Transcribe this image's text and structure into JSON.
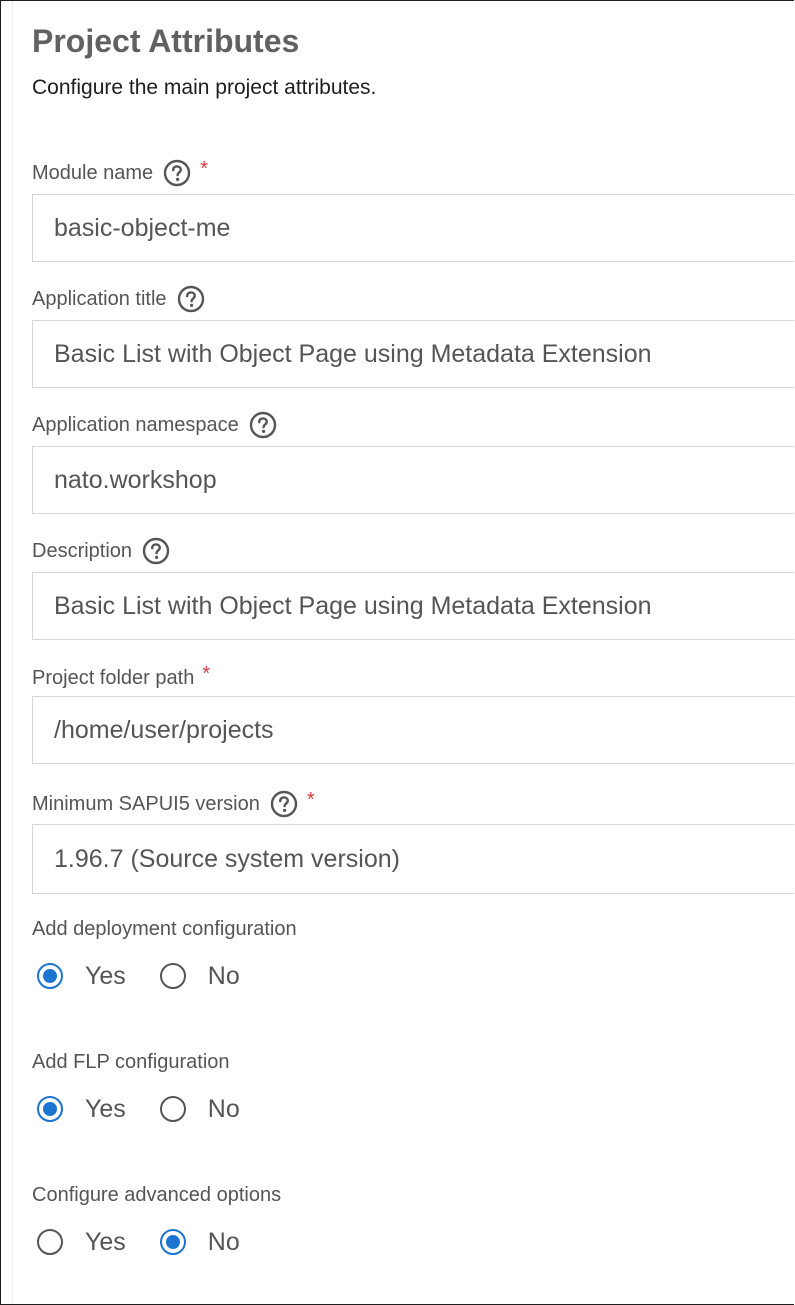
{
  "header": {
    "title": "Project Attributes",
    "subtitle": "Configure the main project attributes."
  },
  "fields": [
    {
      "label": "Module name",
      "value": "basic-object-me",
      "help": true,
      "required": true,
      "help_icon": "question-circle-icon"
    },
    {
      "label": "Application title",
      "value": "Basic List with Object Page using Metadata Extension",
      "help": true,
      "required": false
    },
    {
      "label": "Application namespace",
      "value": "nato.workshop",
      "help": true,
      "required": false
    },
    {
      "label": "Description",
      "value": "Basic List with Object Page using Metadata Extension",
      "help": true,
      "required": false
    },
    {
      "label": "Project folder path",
      "value": "/home/user/projects",
      "help": false,
      "required": true
    },
    {
      "label": "Minimum SAPUI5 version",
      "value": "1.96.7 (Source system version)",
      "help": true,
      "required": true
    }
  ],
  "required_marker": "*",
  "radio_groups": [
    {
      "label": "Add deployment configuration",
      "options": [
        "Yes",
        "No"
      ],
      "selected": "Yes"
    },
    {
      "label": "Add FLP configuration",
      "options": [
        "Yes",
        "No"
      ],
      "selected": "Yes"
    },
    {
      "label": "Configure advanced options",
      "options": [
        "Yes",
        "No"
      ],
      "selected": "No"
    }
  ],
  "colors": {
    "accent": "#1b74d0",
    "required": "#e0383e",
    "text": "#555555",
    "border": "#d6d6d6"
  }
}
